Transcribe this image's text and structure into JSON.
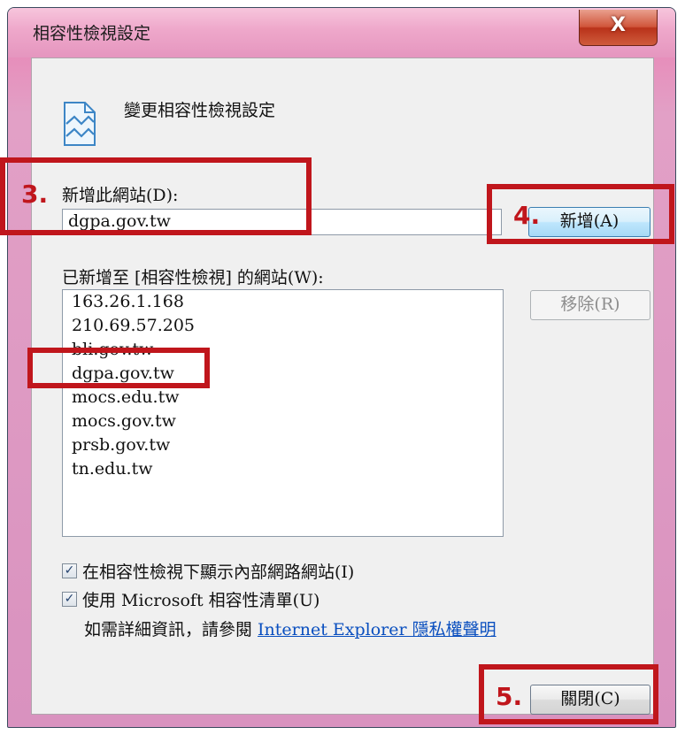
{
  "window": {
    "title": "相容性檢視設定",
    "close_label": "X"
  },
  "header": {
    "icon": "compatibility-view-icon",
    "title": "變更相容性檢視設定"
  },
  "add_site": {
    "label": "新增此網站(D):",
    "value": "dgpa.gov.tw",
    "add_button": "新增(A)"
  },
  "site_list": {
    "label": "已新增至 [相容性檢視] 的網站(W):",
    "items": [
      "163.26.1.168",
      "210.69.57.205",
      "bli.gov.tw",
      "dgpa.gov.tw",
      "mocs.edu.tw",
      "mocs.gov.tw",
      "prsb.gov.tw",
      "tn.edu.tw"
    ],
    "remove_button": "移除(R)"
  },
  "options": {
    "intranet_label": "在相容性檢視下顯示內部網路網站(I)",
    "intranet_checked": true,
    "ms_list_label": "使用 Microsoft 相容性清單(U)",
    "ms_list_checked": true,
    "info_text": "如需詳細資訊，請參閱 ",
    "privacy_link": "Internet Explorer 隱私權聲明"
  },
  "close_button": "關閉(C)",
  "annotations": {
    "step3": "3.",
    "step4": "4.",
    "step5": "5."
  },
  "colors": {
    "highlight": "#c0161c",
    "link": "#0a4fbf"
  }
}
